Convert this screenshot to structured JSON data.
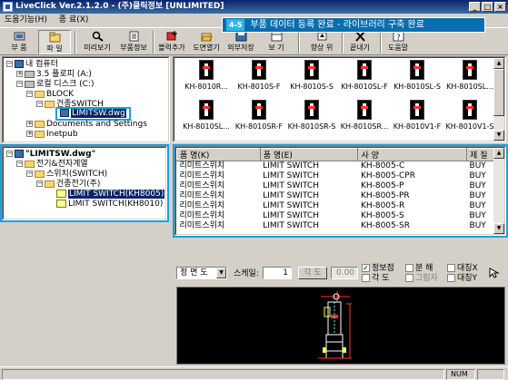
{
  "window": {
    "title": "LiveClick Ver.2.1.2.0 - (주)클릭정보 [UNLIMITED]"
  },
  "menu": [
    "도움기능(H)",
    "종 료(X)"
  ],
  "callout": {
    "number": "4-5",
    "text": "부품 데이터 등록 완료 - 라이브러리 구축 완료"
  },
  "toolbar": [
    {
      "label": "부 품",
      "icon": "parts-icon"
    },
    {
      "label": "파 일",
      "icon": "file-icon"
    },
    {
      "label": "미리보기",
      "icon": "preview-icon"
    },
    {
      "label": "부품정보",
      "icon": "part-info-icon"
    },
    {
      "label": "블럭추가",
      "icon": "add-block-icon"
    },
    {
      "label": "도면열기",
      "icon": "open-drawing-icon"
    },
    {
      "label": "외부저장",
      "icon": "external-save-icon"
    },
    {
      "label": "보 기",
      "icon": "view-icon"
    },
    {
      "label": "향상 위",
      "icon": "up-icon"
    },
    {
      "label": "끝내기",
      "icon": "exit-icon"
    },
    {
      "label": "도움말",
      "icon": "help-icon"
    }
  ],
  "folder_tree": [
    {
      "label": "내 컴퓨터",
      "depth": 0,
      "type": "pc",
      "toggle": "-"
    },
    {
      "label": "3.5 플로피 (A:)",
      "depth": 1,
      "type": "drive",
      "toggle": "+"
    },
    {
      "label": "로컬 디스크 (C:)",
      "depth": 1,
      "type": "drive",
      "toggle": "-"
    },
    {
      "label": "BLOCK",
      "depth": 2,
      "type": "folder",
      "toggle": "-"
    },
    {
      "label": "건종SWITCH",
      "depth": 3,
      "type": "folder",
      "toggle": "-"
    },
    {
      "label": "LIMITSW.dwg",
      "depth": 4,
      "type": "dwg",
      "toggle": ""
    },
    {
      "label": "Documents and Settings",
      "depth": 2,
      "type": "folder",
      "toggle": "+"
    },
    {
      "label": "Inetpub",
      "depth": 2,
      "type": "folder",
      "toggle": "+"
    }
  ],
  "part_tree": [
    {
      "label": "\"LIMITSW.dwg\"",
      "depth": 0,
      "type": "root",
      "toggle": "-"
    },
    {
      "label": "전기&전자계열",
      "depth": 1,
      "type": "folder",
      "toggle": "-"
    },
    {
      "label": "스위치(SWITCH)",
      "depth": 2,
      "type": "folder",
      "toggle": "-"
    },
    {
      "label": "건종전기(주)",
      "depth": 3,
      "type": "folder",
      "toggle": "-"
    },
    {
      "label": "LIMIT SWITCH(KH8005)",
      "depth": 4,
      "type": "comp",
      "toggle": "",
      "selected": true
    },
    {
      "label": "LIMIT SWITCH(KH8010)",
      "depth": 4,
      "type": "comp",
      "toggle": ""
    }
  ],
  "thumbnails": [
    "KH-8010R...",
    "KH-8010S-F",
    "KH-8010S-S",
    "KH-8010SL-F",
    "KH-8010SL-S",
    "KH-8010SL...",
    "KH-8010SL...",
    "KH-8010SR-F",
    "KH-8010SR-S",
    "KH-8010SR...",
    "KH-8010V1-F",
    "KH-8010V1-S"
  ],
  "table": {
    "headers": [
      "품 명(K)",
      "품 명(E)",
      "사 양",
      "제 질"
    ],
    "rows": [
      [
        "리미트스위치",
        "LIMIT SWITCH",
        "KH-8005-C",
        "BUY"
      ],
      [
        "리미트스위치",
        "LIMIT SWITCH",
        "KH-8005-CPR",
        "BUY"
      ],
      [
        "리미트스위치",
        "LIMIT SWITCH",
        "KH-8005-P",
        "BUY"
      ],
      [
        "리미트스위치",
        "LIMIT SWITCH",
        "KH-8005-PR",
        "BUY"
      ],
      [
        "리미트스위치",
        "LIMIT SWITCH",
        "KH-8005-R",
        "BUY"
      ],
      [
        "리미트스위치",
        "LIMIT SWITCH",
        "KH-8005-S",
        "BUY"
      ],
      [
        "리미트스위치",
        "LIMIT SWITCH",
        "KH-8005-SR",
        "BUY"
      ]
    ]
  },
  "preview_controls": {
    "view": "정 면 도",
    "scale_label": "스케일:",
    "scale_value": "1",
    "angle_button": "각 도",
    "angle_value": "0.00",
    "opt_info": "정보점",
    "opt_angle": "각 도",
    "opt_separate": "분 해",
    "opt_grid": "그림자",
    "opt_mirror_x": "대칭X",
    "opt_mirror_y": "대칭Y"
  },
  "status": {
    "num": "NUM"
  },
  "colors": {
    "highlight": "#1aa0e0",
    "title_bar": "#0a246a",
    "selection": "#0a246a"
  }
}
